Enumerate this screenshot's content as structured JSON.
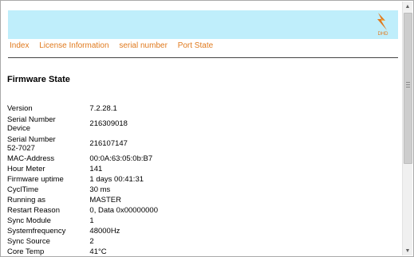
{
  "logo": {
    "text": "DHD",
    "colors": {
      "primary": "#e07a1e",
      "secondary": "#f2b450"
    }
  },
  "nav": {
    "links": [
      "Index",
      "License Information",
      "serial number",
      "Port State"
    ]
  },
  "page_title": "Firmware State",
  "fields": [
    {
      "label": "Version",
      "value": "7.2.28.1"
    },
    {
      "label": "Serial Number Device",
      "value": "216309018"
    },
    {
      "label": "Serial Number 52-7027",
      "value": "216107147"
    },
    {
      "label": "MAC-Address",
      "value": "00:0A:63:05:0b:B7"
    },
    {
      "label": "Hour Meter",
      "value": "141"
    },
    {
      "label": "Firmware uptime",
      "value": "1 days 00:41:31"
    },
    {
      "label": "CyclTime",
      "value": "30 ms"
    },
    {
      "label": "Running as",
      "value": "MASTER"
    },
    {
      "label": "Restart Reason",
      "value": "0, Data 0x00000000"
    },
    {
      "label": "Sync Module",
      "value": "1"
    },
    {
      "label": "Systemfrequency",
      "value": "48000Hz"
    },
    {
      "label": "Sync Source",
      "value": "2"
    },
    {
      "label": "Core Temp",
      "value": "41°C"
    }
  ],
  "colors": {
    "header_bg": "#bfeefb",
    "link": "#e07a1e"
  }
}
